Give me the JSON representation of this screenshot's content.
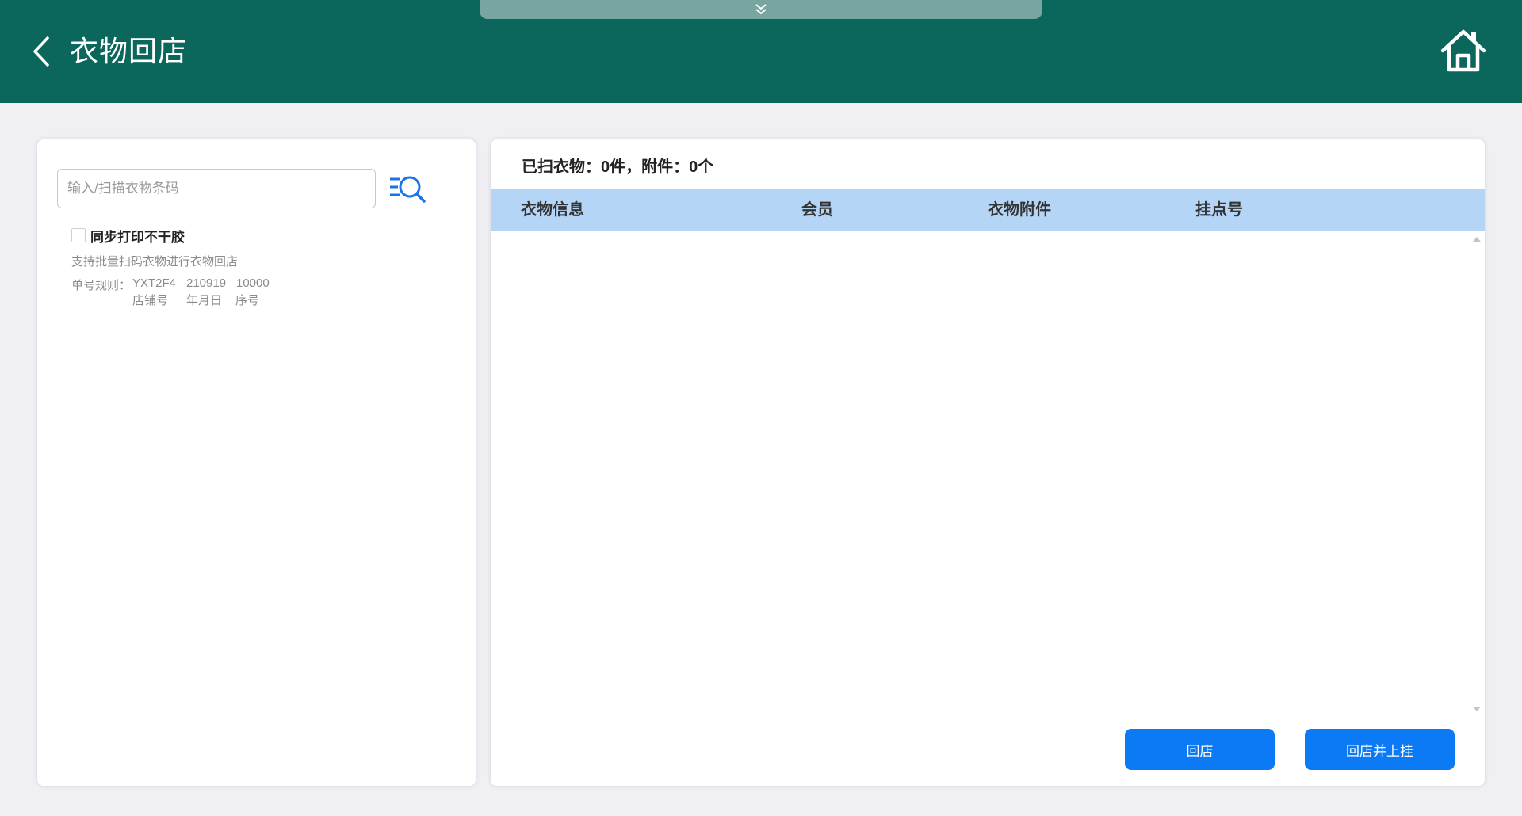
{
  "header": {
    "title": "衣物回店",
    "bg_color": "#0b665c"
  },
  "left": {
    "search": {
      "placeholder": "输入/扫描衣物条码",
      "value": ""
    },
    "sync_print": {
      "label": "同步打印不干胶",
      "checked": false
    },
    "hint": "支持批量扫码衣物进行衣物回店",
    "rule": {
      "label": "单号规则：",
      "parts": [
        {
          "code": "YXT2F4",
          "desc": "店铺号"
        },
        {
          "code": "210919",
          "desc": "年月日"
        },
        {
          "code": "10000",
          "desc": "序号"
        }
      ]
    }
  },
  "right": {
    "scan_count": "已扫衣物：0件，附件：0个",
    "columns": [
      "衣物信息",
      "会员",
      "衣物附件",
      "挂点号"
    ],
    "rows": [],
    "header_bg": "#b5d5f7"
  },
  "actions": {
    "return_label": "回店",
    "return_hang_label": "回店并上挂",
    "color": "#0c7af5"
  }
}
